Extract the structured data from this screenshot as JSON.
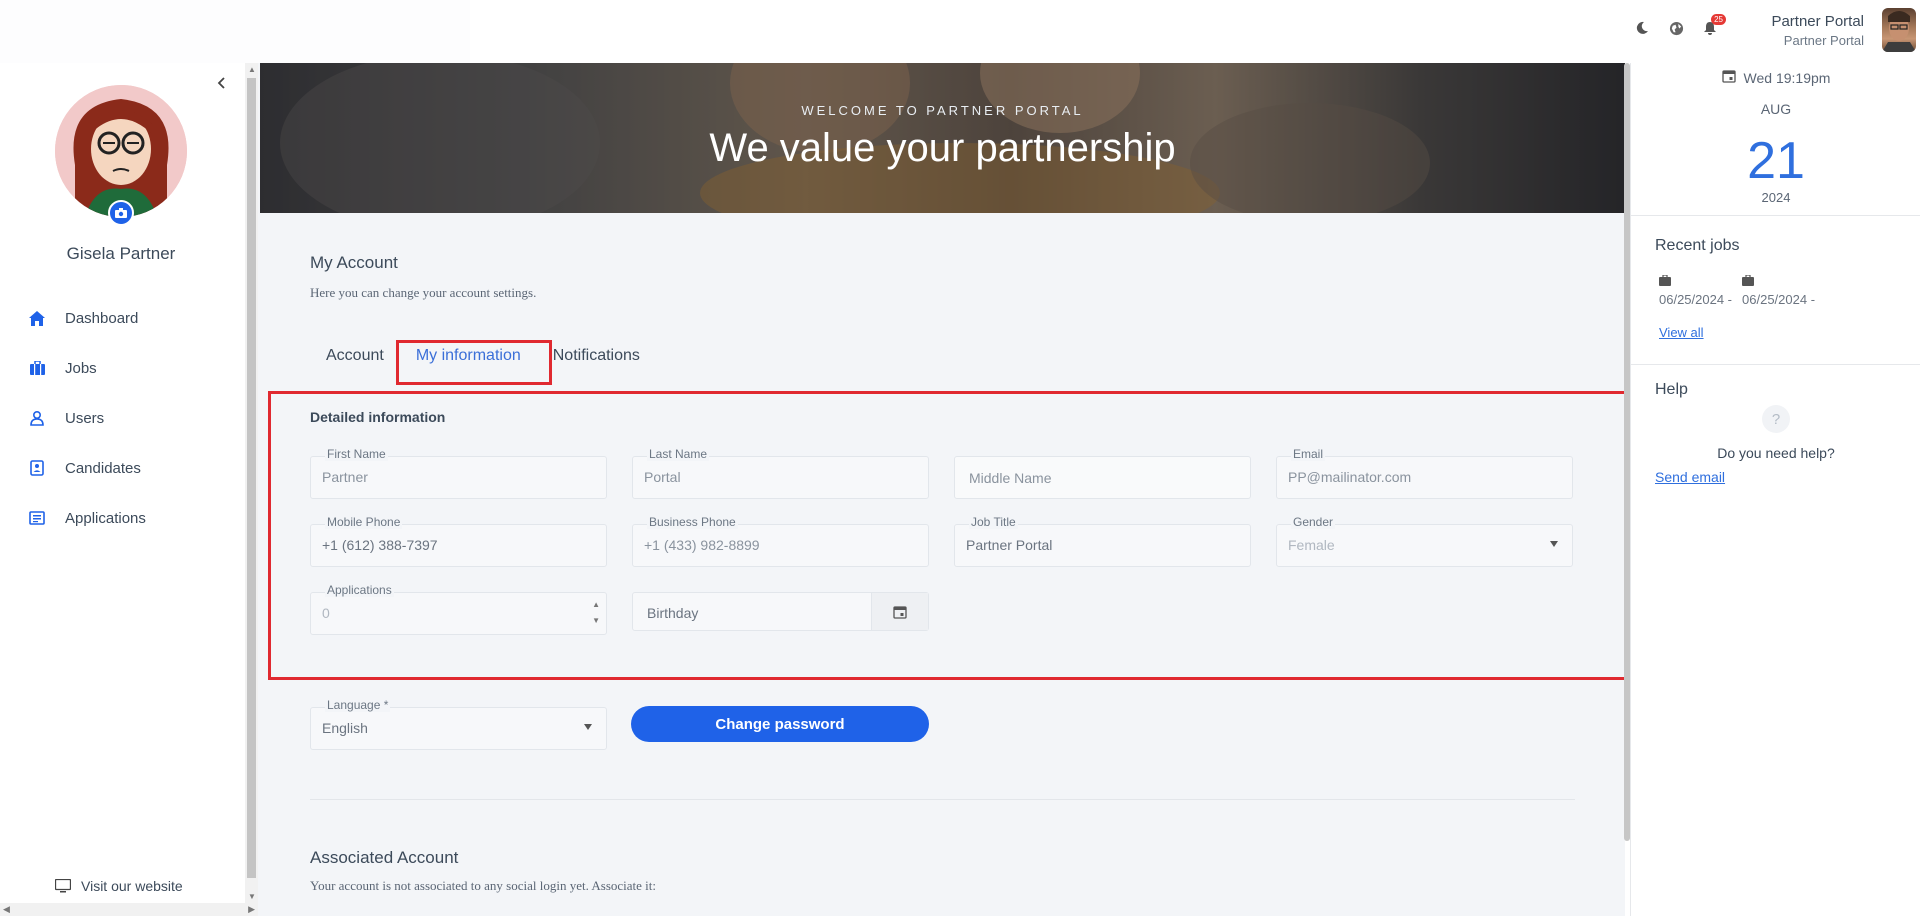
{
  "topbar": {
    "icons": [
      "moon-icon",
      "globe-icon",
      "bell-icon"
    ],
    "notification_count": "25",
    "profile_name": "Partner Portal",
    "profile_sub": "Partner Portal"
  },
  "sidebar": {
    "user_name": "Gisela Partner",
    "items": [
      {
        "label": "Dashboard",
        "icon": "home-icon"
      },
      {
        "label": "Jobs",
        "icon": "briefcase-icon"
      },
      {
        "label": "Users",
        "icon": "user-icon"
      },
      {
        "label": "Candidates",
        "icon": "candidate-icon"
      },
      {
        "label": "Applications",
        "icon": "list-icon"
      }
    ],
    "visit_label": "Visit our website"
  },
  "hero": {
    "kicker": "WELCOME TO PARTNER PORTAL",
    "title": "We value your partnership"
  },
  "account": {
    "title": "My Account",
    "subtitle": "Here you can change your account settings.",
    "tabs": [
      "Account",
      "My information",
      "Notifications"
    ],
    "active_tab": "My information"
  },
  "details": {
    "title": "Detailed information",
    "first_name": {
      "label": "First Name",
      "value": "Partner"
    },
    "last_name": {
      "label": "Last Name",
      "value": "Portal"
    },
    "middle_name": {
      "placeholder": "Middle Name"
    },
    "email": {
      "label": "Email",
      "value": "PP@mailinator.com"
    },
    "mobile_phone": {
      "label": "Mobile Phone",
      "value": "+1 (612) 388-7397"
    },
    "business_phone": {
      "label": "Business Phone",
      "value": "+1 (433) 982-8899"
    },
    "job_title": {
      "label": "Job Title",
      "value": "Partner Portal"
    },
    "gender": {
      "label": "Gender",
      "value": "Female"
    },
    "applications": {
      "label": "Applications",
      "value": "0"
    },
    "birthday": {
      "placeholder": "Birthday"
    }
  },
  "language": {
    "label": "Language *",
    "value": "English"
  },
  "change_password_label": "Change password",
  "associated": {
    "title": "Associated Account",
    "subtitle": "Your account is not associated to any social login yet. Associate it:"
  },
  "right_panel": {
    "datetime": "Wed 19:19pm",
    "month": "AUG",
    "day": "21",
    "year": "2024",
    "recent_jobs_title": "Recent jobs",
    "recent_jobs": [
      "06/25/2024 -",
      "06/25/2024 -"
    ],
    "view_all": "View all",
    "help_title": "Help",
    "help_question": "Do you need help?",
    "send_email": "Send email"
  },
  "colors": {
    "accent": "#1f62e8",
    "highlight": "#e02930",
    "active_tab": "#3b6fd8"
  }
}
